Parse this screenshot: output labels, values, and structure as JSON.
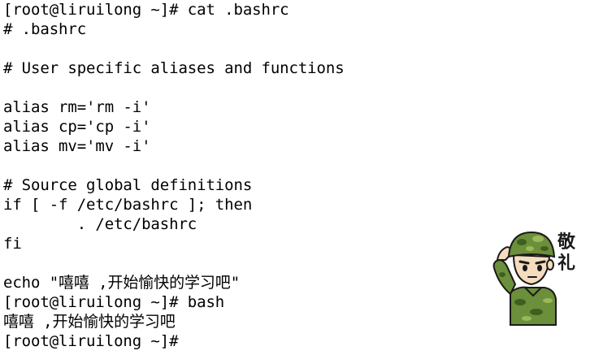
{
  "terminal": {
    "lines": [
      "[root@liruilong ~]# cat .bashrc",
      "# .bashrc",
      "",
      "# User specific aliases and functions",
      "",
      "alias rm='rm -i'",
      "alias cp='cp -i'",
      "alias mv='mv -i'",
      "",
      "# Source global definitions",
      "if [ -f /etc/bashrc ]; then",
      "        . /etc/bashrc",
      "fi",
      "",
      "echo \"嘻嘻 ,开始愉快的学习吧\"",
      "[root@liruilong ~]# bash",
      "嘻嘻 ,开始愉快的学习吧",
      "[root@liruilong ~]#"
    ]
  },
  "sticker": {
    "caption_line1": "敬",
    "caption_line2": "礼",
    "icon": "saluting-soldier-icon",
    "colors": {
      "camo_base": "#6b8f3a",
      "camo_dark": "#3f5f22",
      "camo_light": "#9ab85a",
      "skin": "#f6dcbf",
      "outline": "#1a1a1a"
    }
  }
}
